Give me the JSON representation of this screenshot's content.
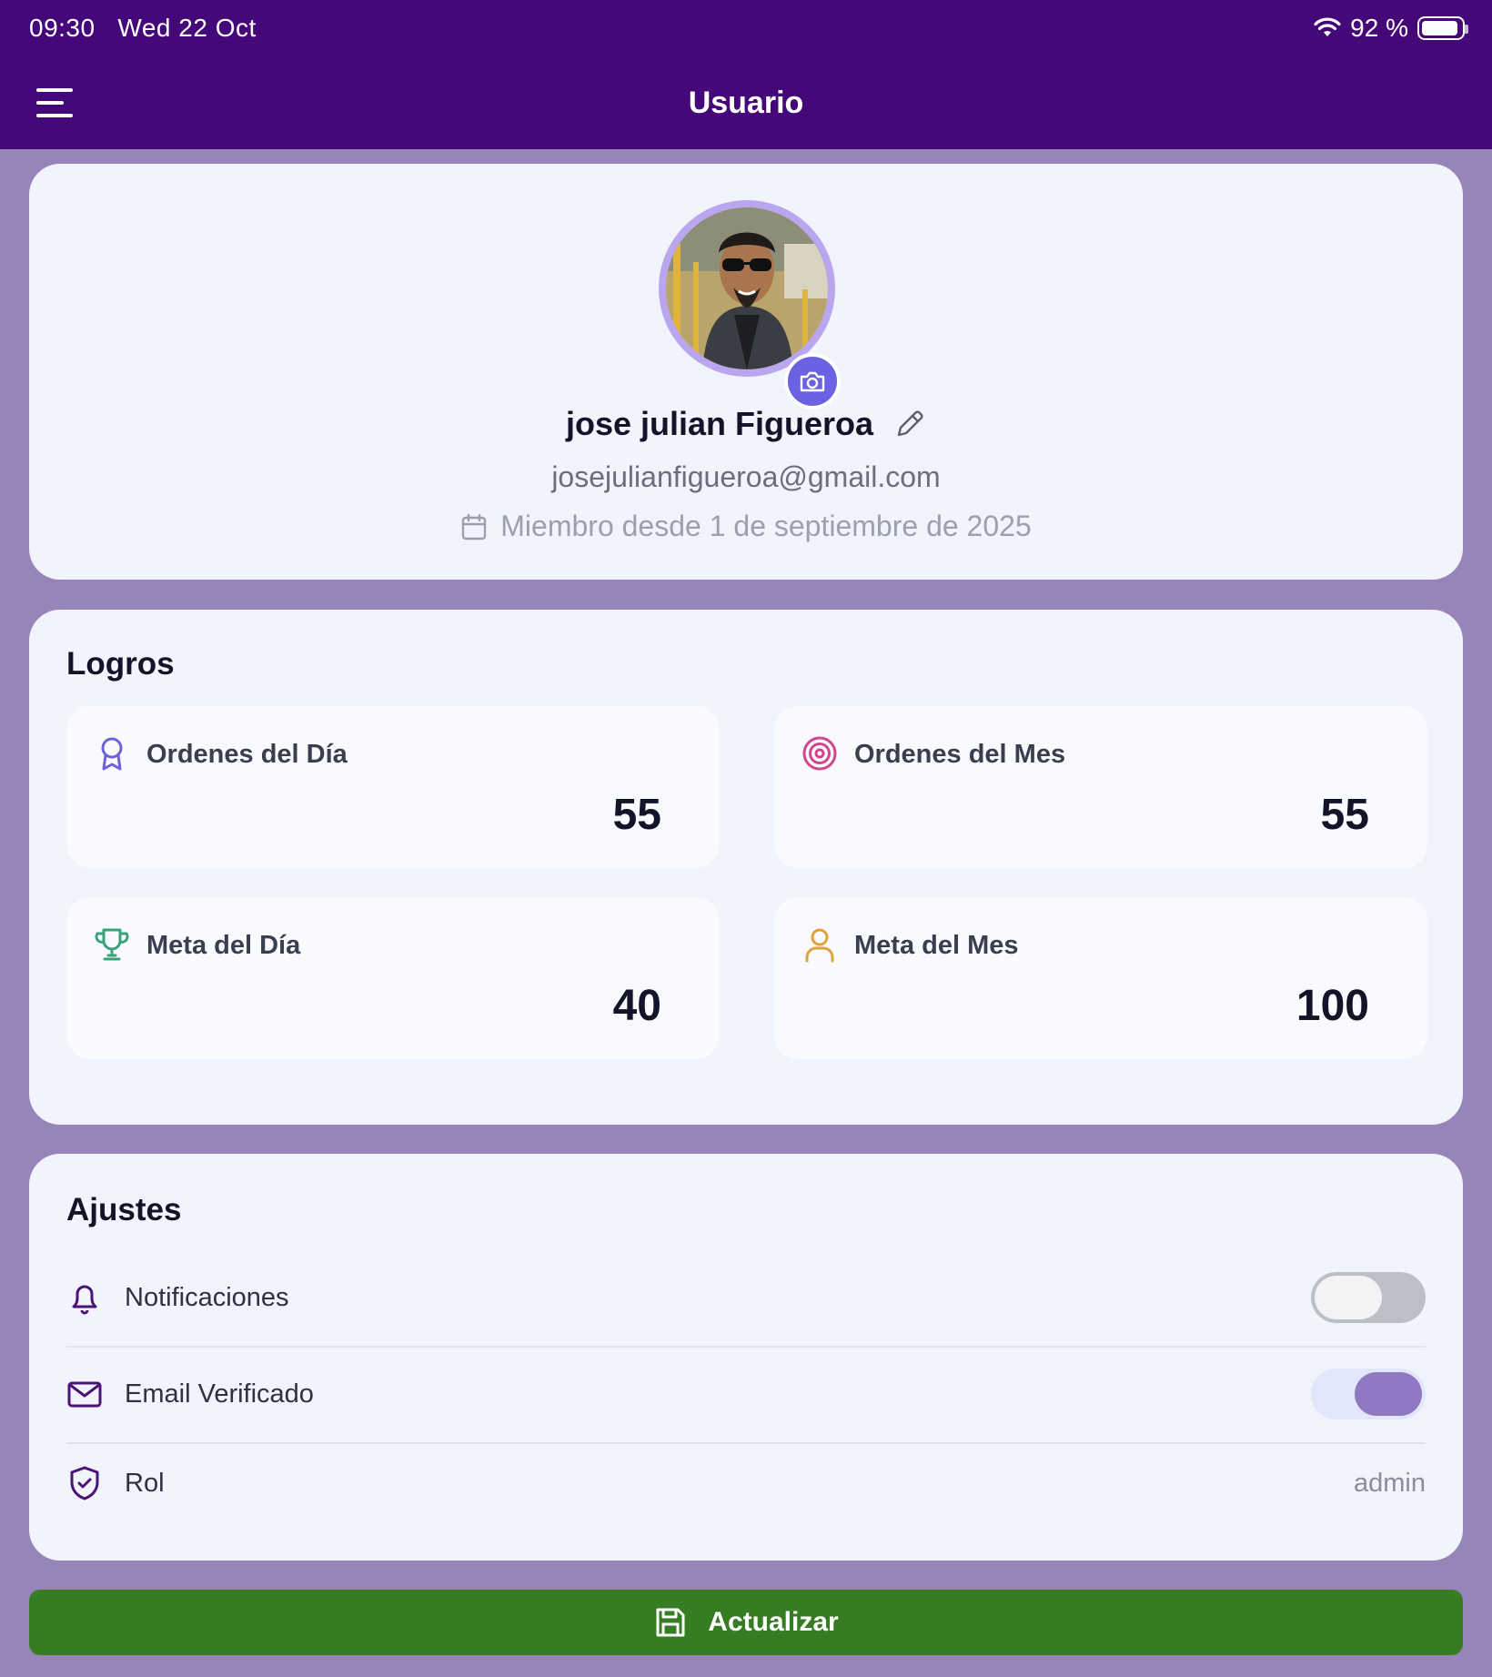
{
  "status_bar": {
    "time": "09:30",
    "date": "Wed 22 Oct",
    "battery": "92 %",
    "battery_level": 0.92,
    "icons": [
      "wifi-icon",
      "battery-icon"
    ]
  },
  "header": {
    "title": "Usuario",
    "menu_icon": "hamburger-menu-icon"
  },
  "profile": {
    "name": "jose julian Figueroa",
    "email": "josejulianfigueroa@gmail.com",
    "member_since": "Miembro desde 1 de septiembre de 2025",
    "edit_icon": "pencil-icon",
    "camera_icon": "camera-icon",
    "calendar_icon": "calendar-icon"
  },
  "logros": {
    "title": "Logros",
    "items": [
      {
        "label": "Ordenes del Día",
        "value": "55",
        "icon": "award-icon",
        "color": "#6b63d8"
      },
      {
        "label": "Ordenes del Mes",
        "value": "55",
        "icon": "target-icon",
        "color": "#d1478f"
      },
      {
        "label": "Meta del Día",
        "value": "40",
        "icon": "trophy-icon",
        "color": "#3aa27a"
      },
      {
        "label": "Meta del Mes",
        "value": "100",
        "icon": "user-icon",
        "color": "#e0a23a"
      }
    ]
  },
  "ajustes": {
    "title": "Ajustes",
    "notifications": {
      "label": "Notificaciones",
      "enabled": false,
      "icon": "bell-icon"
    },
    "email_verified": {
      "label": "Email Verificado",
      "enabled": true,
      "icon": "mail-icon"
    },
    "role": {
      "label": "Rol",
      "value": "admin",
      "icon": "shield-check-icon"
    }
  },
  "actions": {
    "update_label": "Actualizar",
    "update_icon": "save-icon"
  },
  "colors": {
    "header": "#450878",
    "background": "#9784b9",
    "card": "#f1f3fd",
    "button": "#367c22",
    "accent": "#6a62e2"
  }
}
